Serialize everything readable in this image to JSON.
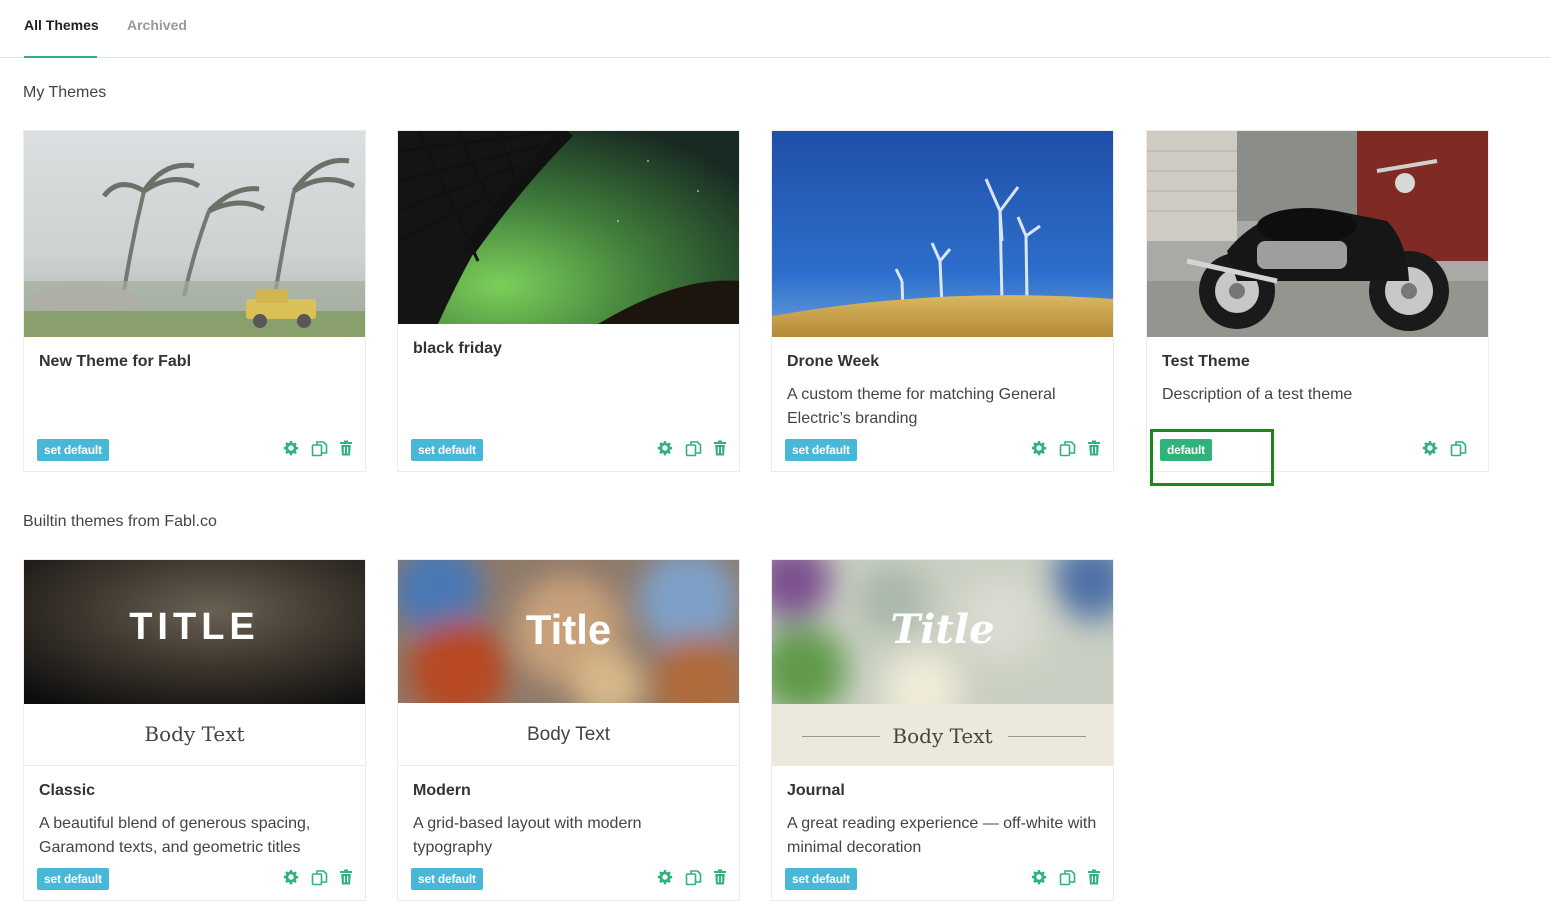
{
  "tabs": [
    {
      "label": "All Themes",
      "active": true
    },
    {
      "label": "Archived",
      "active": false
    }
  ],
  "sections": {
    "my_themes": "My Themes",
    "builtin": "Builtin themes from Fabl.co"
  },
  "my_themes": [
    {
      "name": "New Theme for Fabl",
      "description": "",
      "badge": "set default",
      "image": "storm-palm-trees-image"
    },
    {
      "name": "black friday",
      "description": "",
      "badge": "set default",
      "image": "aurora-bridge-image"
    },
    {
      "name": "Drone Week",
      "description": "A custom theme for matching General Electric’s branding",
      "badge": "set default",
      "image": "wind-turbines-image"
    },
    {
      "name": "Test Theme",
      "description": "Description of a test theme",
      "badge": "default",
      "image": "motorcycle-image"
    }
  ],
  "builtin_themes": [
    {
      "name": "Classic",
      "description": "A beautiful blend of generous spacing, Garamond texts, and geometric titles",
      "badge": "set default",
      "preview_title": "TITLE",
      "preview_body": "Body Text"
    },
    {
      "name": "Modern",
      "description": "A grid-based layout with modern typography",
      "badge": "set default",
      "preview_title": "Title",
      "preview_body": "Body Text"
    },
    {
      "name": "Journal",
      "description": "A great reading experience — off-white with minimal decoration",
      "badge": "set default",
      "preview_title": "Title",
      "preview_body": "Body Text"
    }
  ],
  "icons": {
    "settings": "gear-icon",
    "duplicate": "copy-icon",
    "delete": "trash-icon"
  },
  "colors": {
    "accent_green": "#2fb37a",
    "set_default_blue": "#48b8d9",
    "highlight_box": "#178a17"
  }
}
